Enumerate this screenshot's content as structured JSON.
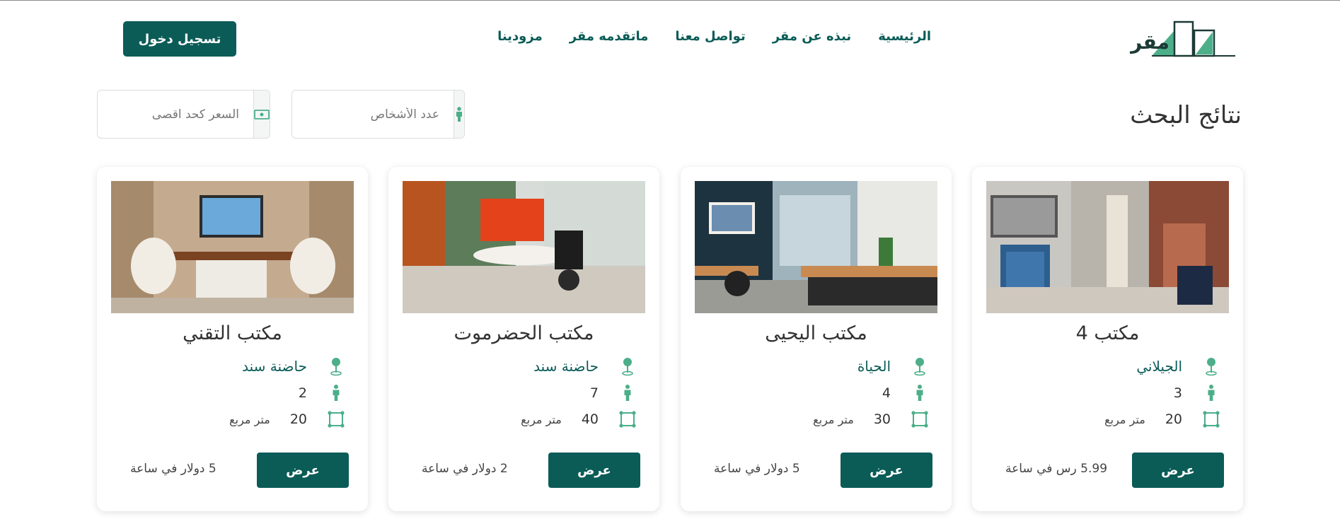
{
  "brand": {
    "name": "مقر"
  },
  "nav": {
    "items": [
      {
        "label": "الرئيسية"
      },
      {
        "label": "نبذه عن مقر"
      },
      {
        "label": "تواصل معنا"
      },
      {
        "label": "ماتقدمه مقر"
      },
      {
        "label": "مزودينا"
      }
    ]
  },
  "header": {
    "login_label": "تسجيل دخول"
  },
  "search": {
    "title": "نتائج البحث",
    "people_placeholder": "عدد الأشخاص",
    "price_placeholder": "السعر كحد اقصى",
    "people_icon": "person-icon",
    "price_icon": "money-icon"
  },
  "colors": {
    "accent": "#0b5c57",
    "icon_green": "#4caf8a"
  },
  "cards": [
    {
      "title": "مكتب 4",
      "location": "الجيلاني",
      "people": "3",
      "area": "20",
      "area_unit": "متر مربع",
      "view_label": "عرض",
      "price": "5.99 رس في ساعة"
    },
    {
      "title": "مكتب اليحيى",
      "location": "الحياة",
      "people": "4",
      "area": "30",
      "area_unit": "متر مربع",
      "view_label": "عرض",
      "price": "5 دولار في ساعة"
    },
    {
      "title": "مكتب الحضرموت",
      "location": "حاضنة سند",
      "people": "7",
      "area": "40",
      "area_unit": "متر مربع",
      "view_label": "عرض",
      "price": "2 دولار في ساعة"
    },
    {
      "title": "مكتب التقني",
      "location": "حاضنة سند",
      "people": "2",
      "area": "20",
      "area_unit": "متر مربع",
      "view_label": "عرض",
      "price": "5 دولار في ساعة"
    }
  ]
}
